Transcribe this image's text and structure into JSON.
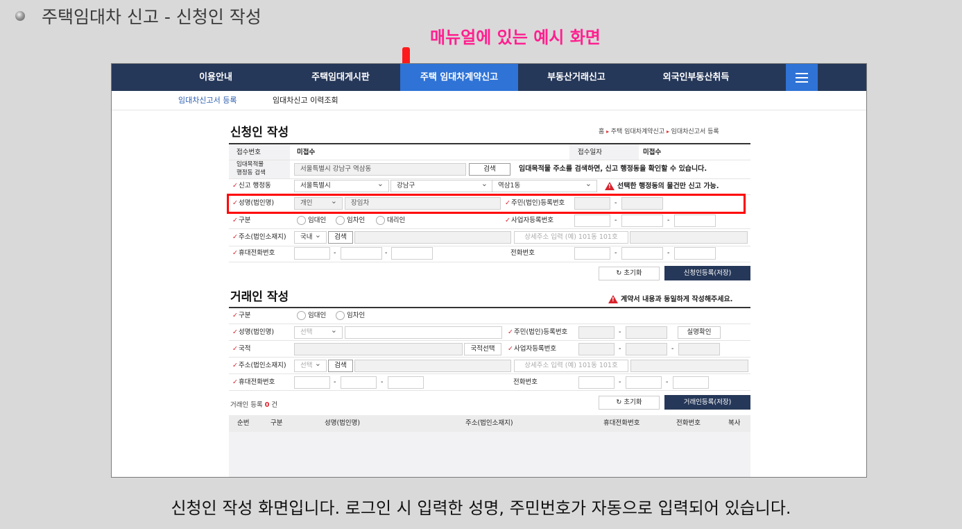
{
  "slide": {
    "title": "주택임대차 신고 - 신청인 작성",
    "example_label": "매뉴얼에 있는 예시 화면",
    "caption": "신청인 작성 화면입니다. 로그인 시 입력한 성명, 주민번호가 자동으로 입력되어 있습니다."
  },
  "nav": {
    "items": [
      "이용안내",
      "주택임대게시판",
      "주택 임대차계약신고",
      "부동산거래신고",
      "외국인부동산취득"
    ],
    "active_index": 2
  },
  "subnav": {
    "items": [
      "임대차신고서 등록",
      "임대차신고 이력조회"
    ]
  },
  "applicant": {
    "heading": "신청인 작성",
    "breadcrumb": [
      "홈",
      "주택 임대차계약신고",
      "임대차신고서 등록"
    ],
    "receipt_label": "접수번호",
    "receipt_value": "미접수",
    "receipt_date_label": "접수일자",
    "receipt_date_value": "미접수",
    "search_label_1": "임대목적물",
    "search_label_2": "행정동 검색",
    "search_value": "서울특별시 강남구 역삼동",
    "search_button": "검색",
    "search_hint": "임대목적물 주소를 검색하면, 신고 행정동을 확인할 수 있습니다.",
    "district_label": "신고 행정동",
    "district_city": "서울특별시",
    "district_gu": "강남구",
    "district_dong": "역삼1동",
    "district_warning": "선택한 행정동의 물건만 신고 가능.",
    "name_label": "성명(법인명)",
    "name_type": "개인",
    "name_value": "장임차",
    "rrn_label": "주민(법인)등록번호",
    "type_label": "구분",
    "type_options": [
      "임대인",
      "임차인",
      "대리인"
    ],
    "biz_label": "사업자등록번호",
    "address_label": "주소(법인소재지)",
    "address_scope": "국내",
    "address_search": "검색",
    "address_detail_placeholder": "상세주소 입력 (예) 101동 101호",
    "mobile_label": "휴대전화번호",
    "phone_label": "전화번호",
    "dash": "-",
    "reset_button": "초기화",
    "save_button": "신청인등록(저장)"
  },
  "party": {
    "heading": "거래인 작성",
    "warning": "계약서 내용과 동일하게 작성해주세요.",
    "type_label": "구분",
    "type_options": [
      "임대인",
      "임차인"
    ],
    "name_label": "성명(법인명)",
    "name_select": "선택",
    "rrn_label": "주민(법인)등록번호",
    "verify_button": "실명확인",
    "nationality_label": "국적",
    "nationality_button": "국적선택",
    "biz_label": "사업자등록번호",
    "address_label": "주소(법인소재지)",
    "address_scope": "선택",
    "address_search": "검색",
    "address_detail_placeholder": "상세주소 입력 (예) 101동 101호",
    "mobile_label": "휴대전화번호",
    "phone_label": "전화번호",
    "count_prefix": "거래인 등록",
    "count_value": "0",
    "count_suffix": "건",
    "reset_button": "초기화",
    "save_button": "거래인등록(저장)",
    "table_headers": [
      "순번",
      "구분",
      "성명(법인명)",
      "주소(법인소재지)",
      "휴대전화번호",
      "전화번호",
      "복사"
    ]
  },
  "colors": {
    "nav_bg": "#263859",
    "nav_active": "#2f73d6",
    "highlight": "#ff0000",
    "example_pink": "#ff1f8f",
    "required_mark": "#d9232d"
  }
}
